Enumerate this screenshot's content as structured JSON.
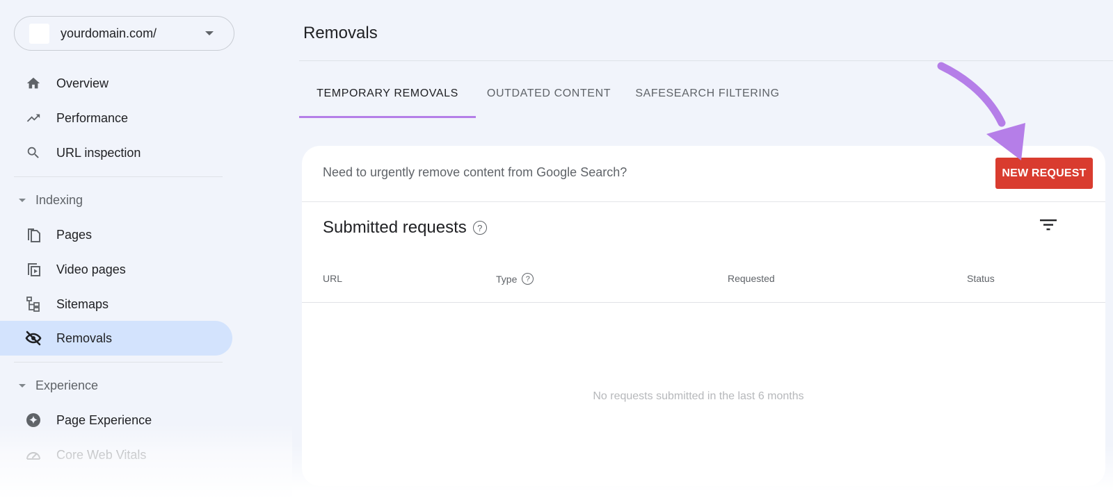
{
  "property": {
    "name": "yourdomain.com/"
  },
  "sidebar": {
    "top_items": [
      {
        "label": "Overview",
        "icon": "home-icon"
      },
      {
        "label": "Performance",
        "icon": "trending-up-icon"
      },
      {
        "label": "URL inspection",
        "icon": "search-icon"
      }
    ],
    "sections": [
      {
        "label": "Indexing",
        "items": [
          {
            "label": "Pages",
            "icon": "pages-icon"
          },
          {
            "label": "Video pages",
            "icon": "video-pages-icon"
          },
          {
            "label": "Sitemaps",
            "icon": "sitemap-icon"
          },
          {
            "label": "Removals",
            "icon": "eye-off-icon",
            "active": true
          }
        ]
      },
      {
        "label": "Experience",
        "items": [
          {
            "label": "Page Experience",
            "icon": "page-experience-icon"
          },
          {
            "label": "Core Web Vitals",
            "icon": "speedometer-icon"
          }
        ]
      }
    ]
  },
  "main": {
    "title": "Removals",
    "tabs": [
      {
        "label": "TEMPORARY REMOVALS",
        "active": true
      },
      {
        "label": "OUTDATED CONTENT",
        "active": false
      },
      {
        "label": "SAFESEARCH FILTERING",
        "active": false
      }
    ],
    "card": {
      "urgent_text": "Need to urgently remove content from Google Search?",
      "new_request_label": "NEW REQUEST",
      "submitted_title": "Submitted requests",
      "help_glyph": "?",
      "columns": [
        "URL",
        "Type",
        "Requested",
        "Status"
      ],
      "rows": [],
      "empty_message": "No requests submitted in the last 6 months"
    }
  },
  "colors": {
    "accent_tab": "#b57ee8",
    "new_request_bg": "#d93c2f",
    "active_nav_bg": "#d3e3fd",
    "annotation_arrow": "#b57ee8"
  }
}
